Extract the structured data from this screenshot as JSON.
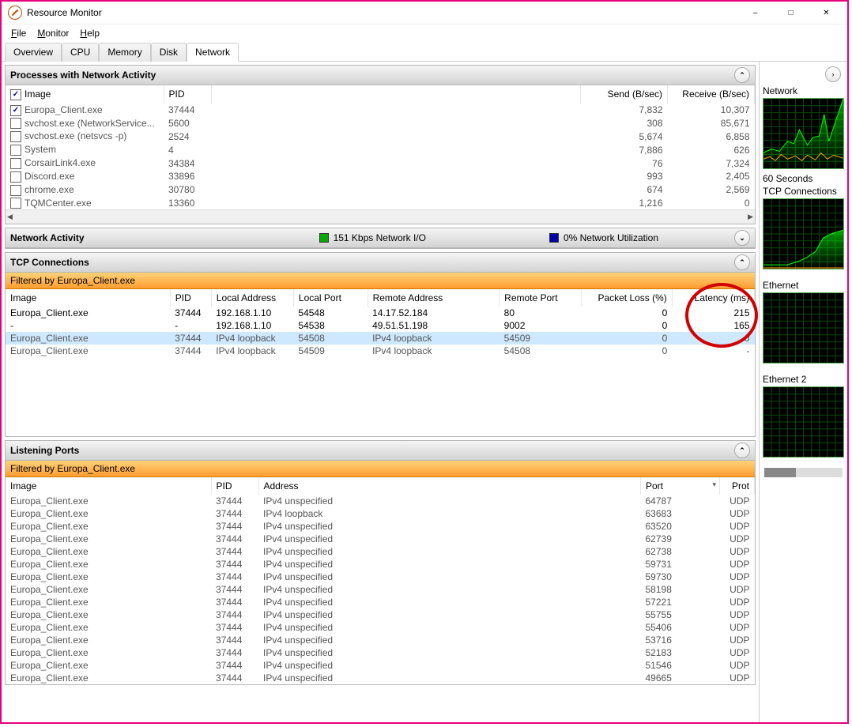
{
  "window": {
    "title": "Resource Monitor"
  },
  "menu": {
    "file": "File",
    "monitor": "Monitor",
    "help": "Help"
  },
  "tabs": {
    "overview": "Overview",
    "cpu": "CPU",
    "memory": "Memory",
    "disk": "Disk",
    "network": "Network"
  },
  "processes_panel": {
    "title": "Processes with Network Activity",
    "cols": {
      "image": "Image",
      "pid": "PID",
      "send": "Send (B/sec)",
      "recv": "Receive (B/sec)"
    },
    "rows": [
      {
        "checked": true,
        "image": "Europa_Client.exe",
        "pid": "37444",
        "send": "7,832",
        "recv": "10,307"
      },
      {
        "checked": false,
        "image": "svchost.exe (NetworkService...",
        "pid": "5600",
        "send": "308",
        "recv": "85,671"
      },
      {
        "checked": false,
        "image": "svchost.exe (netsvcs -p)",
        "pid": "2524",
        "send": "5,674",
        "recv": "6,858"
      },
      {
        "checked": false,
        "image": "System",
        "pid": "4",
        "send": "7,886",
        "recv": "626"
      },
      {
        "checked": false,
        "image": "CorsairLink4.exe",
        "pid": "34384",
        "send": "76",
        "recv": "7,324"
      },
      {
        "checked": false,
        "image": "Discord.exe",
        "pid": "33896",
        "send": "993",
        "recv": "2,405"
      },
      {
        "checked": false,
        "image": "chrome.exe",
        "pid": "30780",
        "send": "674",
        "recv": "2,569"
      },
      {
        "checked": false,
        "image": "TQMCenter.exe",
        "pid": "13360",
        "send": "1,216",
        "recv": "0"
      }
    ]
  },
  "network_activity_panel": {
    "title": "Network Activity",
    "io": "151 Kbps Network I/O",
    "util": "0% Network Utilization"
  },
  "tcp_panel": {
    "title": "TCP Connections",
    "filter": "Filtered by Europa_Client.exe",
    "cols": {
      "image": "Image",
      "pid": "PID",
      "laddr": "Local Address",
      "lport": "Local Port",
      "raddr": "Remote Address",
      "rport": "Remote Port",
      "loss": "Packet Loss (%)",
      "lat": "Latency (ms)"
    },
    "rows": [
      {
        "image": "Europa_Client.exe",
        "pid": "37444",
        "laddr": "192.168.1.10",
        "lport": "54548",
        "raddr": "14.17.52.184",
        "rport": "80",
        "loss": "0",
        "lat": "215",
        "bold": true
      },
      {
        "image": "-",
        "pid": "-",
        "laddr": "192.168.1.10",
        "lport": "54538",
        "raddr": "49.51.51.198",
        "rport": "9002",
        "loss": "0",
        "lat": "165",
        "bold": true
      },
      {
        "image": "Europa_Client.exe",
        "pid": "37444",
        "laddr": "IPv4 loopback",
        "lport": "54508",
        "raddr": "IPv4 loopback",
        "rport": "54509",
        "loss": "0",
        "lat": "0",
        "selected": true
      },
      {
        "image": "Europa_Client.exe",
        "pid": "37444",
        "laddr": "IPv4 loopback",
        "lport": "54509",
        "raddr": "IPv4 loopback",
        "rport": "54508",
        "loss": "0",
        "lat": "-"
      }
    ]
  },
  "listen_panel": {
    "title": "Listening Ports",
    "filter": "Filtered by Europa_Client.exe",
    "cols": {
      "image": "Image",
      "pid": "PID",
      "addr": "Address",
      "port": "Port",
      "prot": "Prot"
    },
    "rows": [
      {
        "image": "Europa_Client.exe",
        "pid": "37444",
        "addr": "IPv4 unspecified",
        "port": "64787",
        "prot": "UDP"
      },
      {
        "image": "Europa_Client.exe",
        "pid": "37444",
        "addr": "IPv4 loopback",
        "port": "63683",
        "prot": "UDP"
      },
      {
        "image": "Europa_Client.exe",
        "pid": "37444",
        "addr": "IPv4 unspecified",
        "port": "63520",
        "prot": "UDP"
      },
      {
        "image": "Europa_Client.exe",
        "pid": "37444",
        "addr": "IPv4 unspecified",
        "port": "62739",
        "prot": "UDP"
      },
      {
        "image": "Europa_Client.exe",
        "pid": "37444",
        "addr": "IPv4 unspecified",
        "port": "62738",
        "prot": "UDP"
      },
      {
        "image": "Europa_Client.exe",
        "pid": "37444",
        "addr": "IPv4 unspecified",
        "port": "59731",
        "prot": "UDP"
      },
      {
        "image": "Europa_Client.exe",
        "pid": "37444",
        "addr": "IPv4 unspecified",
        "port": "59730",
        "prot": "UDP"
      },
      {
        "image": "Europa_Client.exe",
        "pid": "37444",
        "addr": "IPv4 unspecified",
        "port": "58198",
        "prot": "UDP"
      },
      {
        "image": "Europa_Client.exe",
        "pid": "37444",
        "addr": "IPv4 unspecified",
        "port": "57221",
        "prot": "UDP"
      },
      {
        "image": "Europa_Client.exe",
        "pid": "37444",
        "addr": "IPv4 unspecified",
        "port": "55755",
        "prot": "UDP"
      },
      {
        "image": "Europa_Client.exe",
        "pid": "37444",
        "addr": "IPv4 unspecified",
        "port": "55406",
        "prot": "UDP"
      },
      {
        "image": "Europa_Client.exe",
        "pid": "37444",
        "addr": "IPv4 unspecified",
        "port": "53716",
        "prot": "UDP"
      },
      {
        "image": "Europa_Client.exe",
        "pid": "37444",
        "addr": "IPv4 unspecified",
        "port": "52183",
        "prot": "UDP"
      },
      {
        "image": "Europa_Client.exe",
        "pid": "37444",
        "addr": "IPv4 unspecified",
        "port": "51546",
        "prot": "UDP"
      },
      {
        "image": "Europa_Client.exe",
        "pid": "37444",
        "addr": "IPv4 unspecified",
        "port": "49665",
        "prot": "UDP"
      }
    ]
  },
  "sidebar": {
    "network": "Network",
    "sixty": "60 Seconds",
    "tcp": "TCP Connections",
    "eth": "Ethernet",
    "eth2": "Ethernet 2"
  }
}
